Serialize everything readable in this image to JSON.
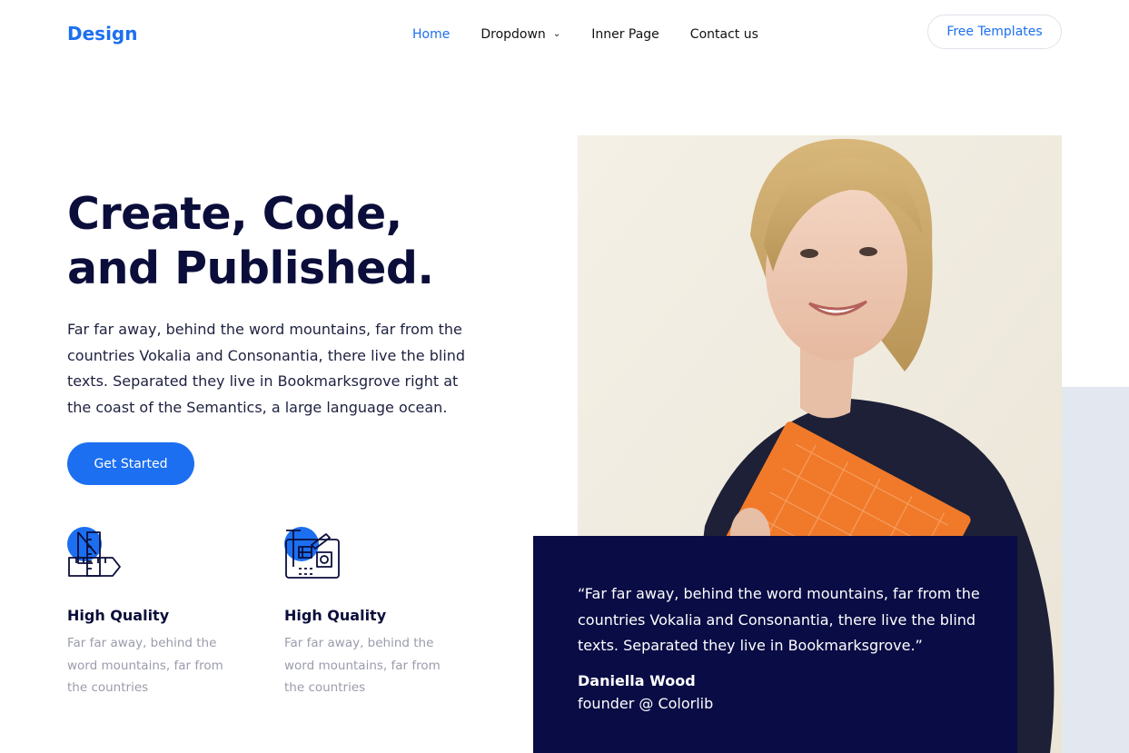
{
  "nav": {
    "brand": "Design",
    "items": [
      {
        "label": "Home",
        "active": true
      },
      {
        "label": "Dropdown",
        "has_dropdown": true
      },
      {
        "label": "Inner Page"
      },
      {
        "label": "Contact us"
      }
    ],
    "cta_label": "Free Templates"
  },
  "hero": {
    "title_line1": "Create, Code,",
    "title_line2": "and Published.",
    "text": "Far far away, behind the word mountains, far from the countries Vokalia and Consonantia, there live the blind texts. Separated they live in Bookmarksgrove right at the coast of the Semantics, a large language ocean.",
    "cta_label": "Get Started"
  },
  "features": [
    {
      "icon": "design-tools-icon",
      "title": "High Quality",
      "text": "Far far away, behind the word mountains, far from the countries"
    },
    {
      "icon": "blueprint-icon",
      "title": "High Quality",
      "text": "Far far away, behind the word mountains, far from the countries"
    }
  ],
  "testimonial": {
    "quote": "“Far far away, behind the word mountains, far from the countries Vokalia and Consonantia, there live the blind texts. Separated they live in Bookmarksgrove.”",
    "author": "Daniella Wood",
    "role": "founder @ Colorlib"
  },
  "colors": {
    "accent": "#1c6ff0",
    "dark_navy": "#090c45",
    "heading": "#0b0d3a",
    "muted_text": "#9a9cab",
    "side_block": "#e3e7ef"
  }
}
